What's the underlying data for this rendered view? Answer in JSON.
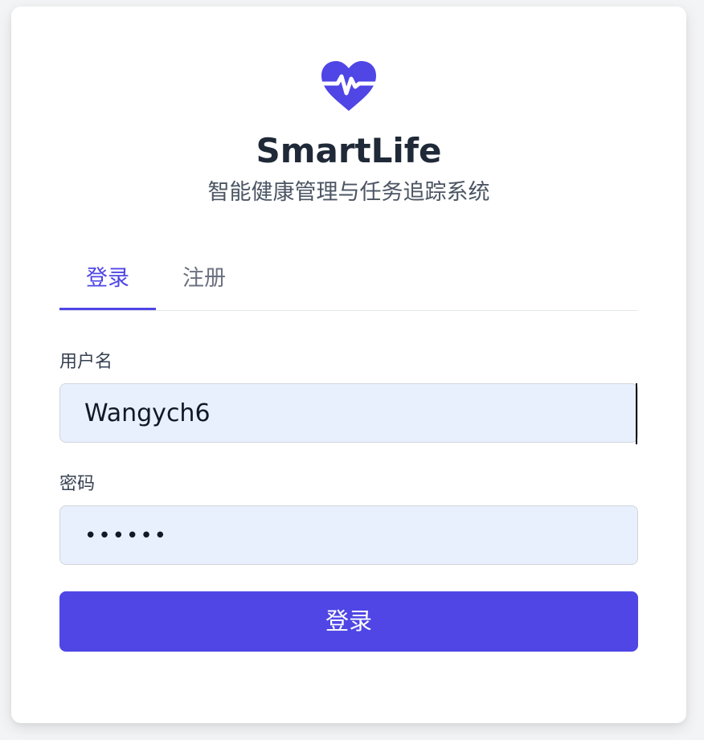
{
  "app": {
    "title": "SmartLife",
    "subtitle": "智能健康管理与任务追踪系统",
    "logo_icon": "heart-pulse-icon",
    "accent_color": "#4f46e5"
  },
  "tabs": {
    "login_label": "登录",
    "register_label": "注册",
    "active": "login"
  },
  "form": {
    "username_label": "用户名",
    "username_value": "Wangych6",
    "password_label": "密码",
    "password_value": "••••••",
    "submit_label": "登录"
  }
}
